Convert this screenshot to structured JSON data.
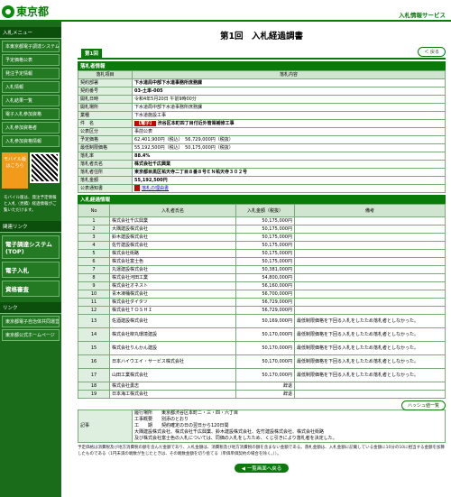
{
  "header": {
    "logo": "東京都",
    "service": "入札情報サービス"
  },
  "sidebar": {
    "menu_title": "入札メニュー",
    "items": [
      "本東京都電子調達システム",
      "予定価格公表",
      "発注予定情報",
      "入札情報",
      "入札結果一覧",
      "電子入札参加資格",
      "入札参加資格者",
      "入札参加資格情報"
    ],
    "mobile_tag": "モバイル版はこちら",
    "mobile_note": "モバイル版は、発注予定情報と入札（見積）経過情報がご覧いただけます。",
    "links_title": "関連リンク",
    "big_items": [
      "電子調達システム(TOP)",
      "電子入札",
      "資格審査"
    ],
    "links2_title": "リンク",
    "link_items": [
      "東京都電子自治体共同運営",
      "東京都公式ホームページ"
    ]
  },
  "main": {
    "title": "第1回　入札経過調書",
    "tab": "第1回",
    "back_label": "＜ 戻る",
    "sec1": "落札者情報",
    "col_item": "落札項目",
    "col_content": "落札内容",
    "rows": [
      {
        "label": "契約部署",
        "value": "下水道局中部下水道事務所庶務課",
        "bold": true
      },
      {
        "label": "契約番号",
        "value": "03-土単-005",
        "bold": true
      },
      {
        "label": "開札日時",
        "value": "令和4年5月20日 午前9時00分"
      },
      {
        "label": "開札場所",
        "value": "下水道局中部下水道事務所庶務課"
      },
      {
        "label": "業種",
        "value": "下水道施設工事"
      },
      {
        "label": "件　名",
        "tag": "【電子】",
        "value": "渋谷区本町四丁目付近外管渠補修工事",
        "bold": true
      },
      {
        "label": "公表区分",
        "value": "事前公表"
      },
      {
        "label": "予定価格",
        "value": "62,401,900円（税込）　56,729,000円（税抜）"
      },
      {
        "label": "最低制限価格",
        "value": "55,192,500円（税込）　50,175,000円（税抜）"
      },
      {
        "label": "落札率",
        "value": "88.4%",
        "bold": true
      },
      {
        "label": "落札者氏名",
        "value": "株式会社千広興業",
        "bold": true
      },
      {
        "label": "落札者住所",
        "value": "東京都目黒区祐天寺二丁目８番８号ＥＮ祐天寺３０２号",
        "bold": true
      },
      {
        "label": "落札金額",
        "value": "55,192,500円",
        "bold": true
      },
      {
        "label": "公表通知書",
        "value": "落札の理由書",
        "link": true
      }
    ],
    "sec2": "入札経過情報",
    "bid_headers": [
      "No",
      "入札者氏名",
      "入札金額（税抜）",
      "備考"
    ],
    "bids": [
      {
        "no": "1",
        "name": "株式会社千広興業",
        "amount": "50,175,000円",
        "note": ""
      },
      {
        "no": "2",
        "name": "大隅建設株式会社",
        "amount": "50,175,000円",
        "note": ""
      },
      {
        "no": "3",
        "name": "鈴木建設株式会社",
        "amount": "50,175,000円",
        "note": ""
      },
      {
        "no": "4",
        "name": "佐竹建設株式会社",
        "amount": "50,175,000円",
        "note": ""
      },
      {
        "no": "5",
        "name": "株式会社街路",
        "amount": "50,175,000円",
        "note": ""
      },
      {
        "no": "6",
        "name": "株式会社富士色",
        "amount": "50,175,000円",
        "note": ""
      },
      {
        "no": "7",
        "name": "丸運建設株式会社",
        "amount": "50,381,000円",
        "note": ""
      },
      {
        "no": "8",
        "name": "株式会社河田工業",
        "amount": "54,800,000円",
        "note": ""
      },
      {
        "no": "9",
        "name": "株式会社オネスト",
        "amount": "56,160,000円",
        "note": ""
      },
      {
        "no": "10",
        "name": "青木凍桶株式会社",
        "amount": "56,700,000円",
        "note": ""
      },
      {
        "no": "11",
        "name": "株式会社ダイタツ",
        "amount": "56,729,000円",
        "note": ""
      },
      {
        "no": "12",
        "name": "株式会社ＴＯＳＨＩ",
        "amount": "56,729,000円",
        "note": ""
      },
      {
        "no": "13",
        "name": "佐酒建設株式会社",
        "amount": "50,169,000円",
        "note": "最低制限価格を下回る入札をしたため落札者としなかった。",
        "tall": true
      },
      {
        "no": "14",
        "name": "株式会社柳丸環境建設",
        "amount": "50,170,000円",
        "note": "最低制限価格を下回る入札をしたため落札者としなかった。",
        "tall": true
      },
      {
        "no": "15",
        "name": "株式会社りんかん建設",
        "amount": "50,170,000円",
        "note": "最低制限価格を下回る入札をしたため落札者としなかった。",
        "tall": true
      },
      {
        "no": "16",
        "name": "日本ハイウエイ・サービス株式会社",
        "amount": "50,170,000円",
        "note": "最低制限価格を下回る入札をしたため落札者としなかった。",
        "tall": true
      },
      {
        "no": "17",
        "name": "山田工業株式会社",
        "amount": "50,170,000円",
        "note": "最低制限価格を下回る入札をしたため落札者としなかった。",
        "tall": true
      },
      {
        "no": "18",
        "name": "株式会社勇志",
        "amount": "辞退",
        "note": ""
      },
      {
        "no": "19",
        "name": "日本海工株式会社",
        "amount": "辞退",
        "note": ""
      }
    ],
    "history_label": "ハッシュ値一覧",
    "note_label": "記事",
    "note_lines": [
      "履行場所　　東京都渋谷区本町二・三・四・六丁目",
      "工事概要　　別添のとおり",
      "工　　期　　契約確定の日の翌日から120日間",
      "大隅建設株式会社、株式会社千広興業、鈴木建設株式会社、佐竹建設株式会社、株式会社街路",
      "及び株式会社富士色の入札については、同価の入札をしたため、くじ引きにより落札者を決定した。"
    ],
    "footnote": "予定価格は消費税及び地方消費税の額を含んだ金額であり、入札金額は、消費税及び地方消費税の額を含まない金額である。落札金額は、入札金額に記載している金額に10分の10に相当する金額を加算したものである（1円未満の端数が生じたときは、その端数金額を切り捨てる（単価単価契約の場合を除く。））。",
    "prev_label": "◀ 一覧画面へ戻る"
  }
}
